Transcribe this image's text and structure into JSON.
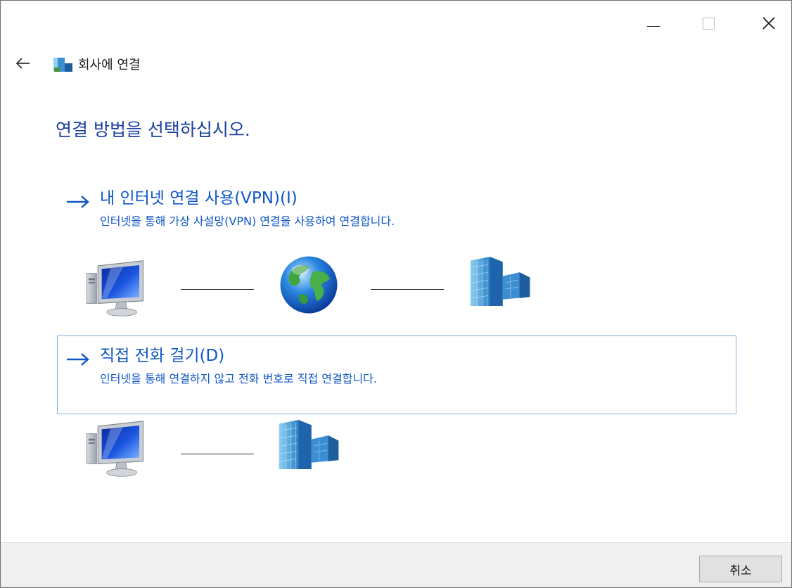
{
  "window": {
    "minimize_icon": "minimize-icon",
    "maximize_icon": "maximize-icon",
    "close_icon": "close-icon"
  },
  "nav": {
    "back_icon": "back-arrow-icon",
    "app_icon": "company-network-icon",
    "breadcrumb": "회사에 연결"
  },
  "page": {
    "title": "연결 방법을 선택하십시오."
  },
  "options": [
    {
      "title": "내 인터넷 연결 사용(VPN)(I)",
      "description": "인터넷을 통해 가상 사설망(VPN) 연결을 사용하여 연결합니다.",
      "icons": [
        "computer-icon",
        "globe-icon",
        "office-building-icon"
      ],
      "selected": false
    },
    {
      "title": "직접 전화 걸기(D)",
      "description": "인터넷을 통해 연결하지 않고 전화 번호로 직접 연결합니다.",
      "icons": [
        "computer-icon",
        "office-building-icon"
      ],
      "selected": true
    }
  ],
  "footer": {
    "cancel_label": "취소"
  },
  "colors": {
    "title_blue": "#1b3fa0",
    "link_blue": "#0f56c7",
    "selection_border": "#7fb1e4",
    "footer_bg": "#f0f0f0"
  }
}
